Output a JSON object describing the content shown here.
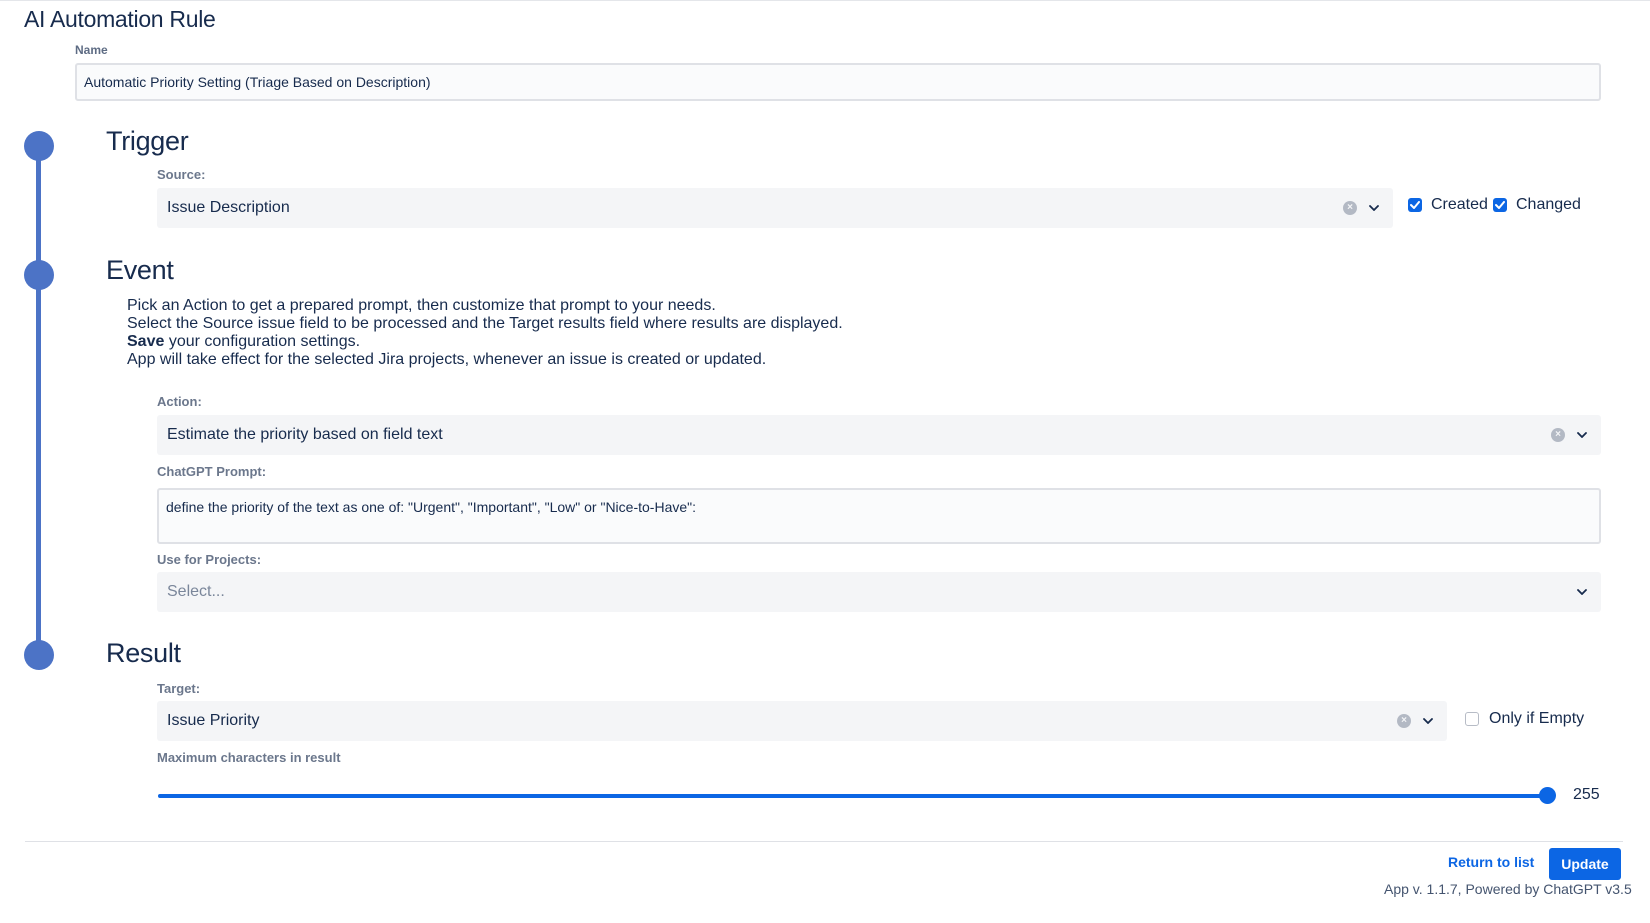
{
  "page": {
    "title": "AI Automation Rule"
  },
  "name_field": {
    "label": "Name",
    "value": "Automatic Priority Setting (Triage Based on Description)"
  },
  "trigger": {
    "title": "Trigger",
    "source_label": "Source:",
    "source_value": "Issue Description",
    "created_label": "Created",
    "created_checked": true,
    "changed_label": "Changed",
    "changed_checked": true
  },
  "event": {
    "title": "Event",
    "description": {
      "line1": "Pick an Action to get a prepared prompt, then customize that prompt to your needs.",
      "line2": "Select the Source issue field to be processed and the Target results field where results are displayed.",
      "line3_bold": "Save",
      "line3_rest": " your configuration settings.",
      "line4": "App will take effect for the selected Jira projects, whenever an issue is created or updated."
    },
    "action_label": "Action:",
    "action_value": "Estimate the priority based on field text",
    "prompt_label": "ChatGPT Prompt:",
    "prompt_value": "define the priority of the text as one of: \"Urgent\", \"Important\", \"Low\" or \"Nice-to-Have\":",
    "projects_label": "Use for Projects:",
    "projects_placeholder": "Select..."
  },
  "result": {
    "title": "Result",
    "target_label": "Target:",
    "target_value": "Issue Priority",
    "only_if_empty_label": "Only if Empty",
    "only_if_empty_checked": false,
    "max_chars_label": "Maximum characters in result",
    "max_chars_value": "255",
    "max_chars_fraction": 1.0
  },
  "footer": {
    "return_label": "Return to list",
    "update_label": "Update",
    "version_text": "App v. 1.1.7, Powered by ChatGPT v3.5"
  },
  "colors": {
    "accent": "#0c66e4",
    "timeline": "#4c73c6",
    "field_bg": "#f4f5f7"
  },
  "icons": [
    "clear-icon",
    "chevron-down-icon",
    "checkbox-checked-icon"
  ]
}
